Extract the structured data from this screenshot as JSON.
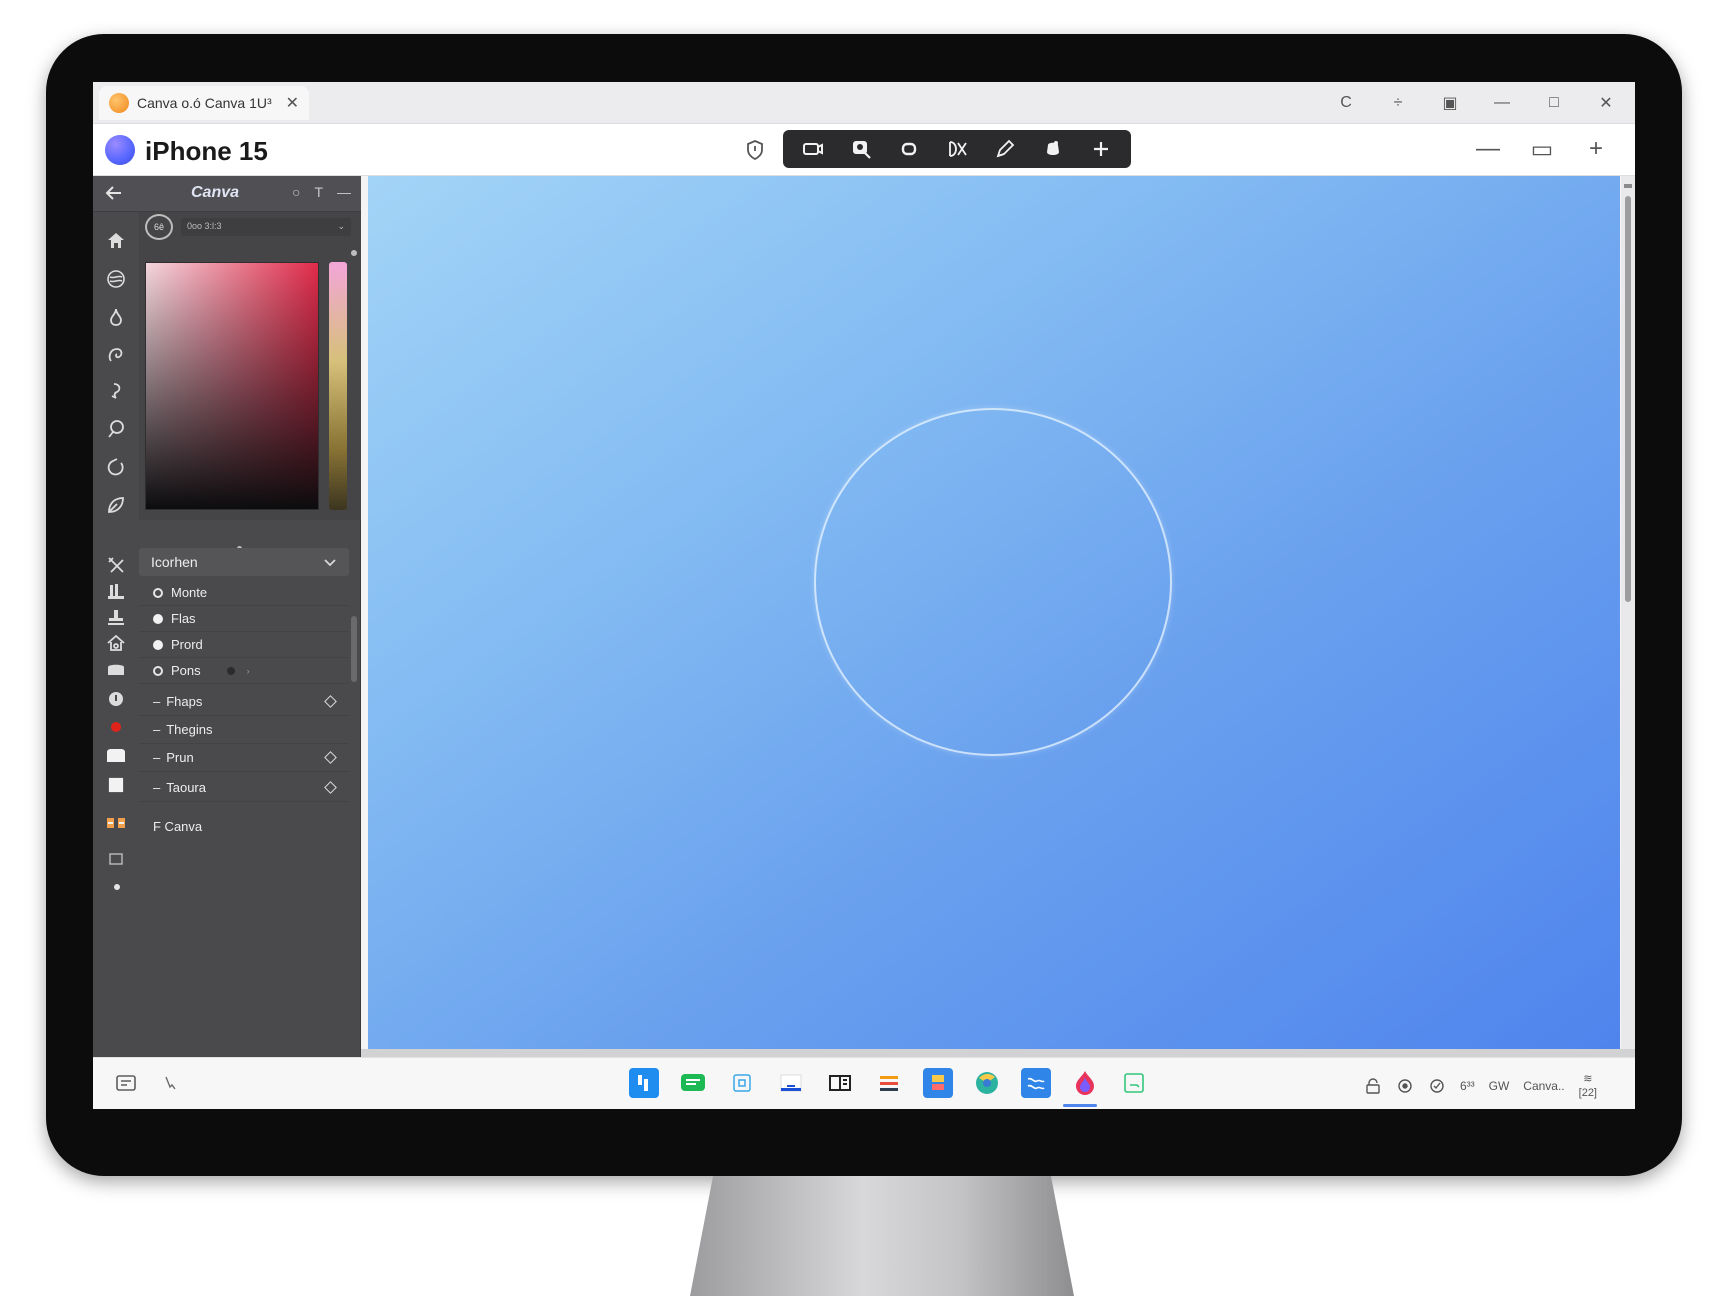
{
  "browser": {
    "tab_title": "Canva o.ó Canva 1U³",
    "tab_close": "✕",
    "controls": [
      "C",
      "÷",
      "▣",
      "—",
      "□",
      "✕"
    ]
  },
  "app": {
    "title": "iPhone 15",
    "zoom_out": "—",
    "zoom_fit": "▭",
    "zoom_in": "+"
  },
  "panel": {
    "title": "Canva",
    "color_value": "0oo 3:l:3",
    "eyedropper_label": "6ê",
    "dropdown": {
      "label": "Icorhen"
    },
    "options": [
      {
        "label": "Monte",
        "filled": false
      },
      {
        "label": "Flas",
        "filled": true
      },
      {
        "label": "Prord",
        "filled": true
      },
      {
        "label": "Pons",
        "filled": false
      }
    ],
    "groups": [
      {
        "label": "Fhaps",
        "dash": "–"
      },
      {
        "label": "Thegins",
        "dash": "–"
      },
      {
        "label": "Prun",
        "dash": "–"
      },
      {
        "label": "Taoura",
        "dash": "–"
      }
    ],
    "footer_label": "F Canva",
    "pons_arrow": "›"
  },
  "icons": {
    "rail": [
      "home-icon",
      "globe-icon",
      "drop-icon",
      "spiral-icon",
      "hook-icon",
      "lasso-icon",
      "rotate-icon",
      "leaf-icon"
    ],
    "toolbar": [
      "camera-icon",
      "image-search-icon",
      "shape-icon",
      "cut-icon",
      "pen-icon",
      "fill-icon",
      "plus-icon"
    ],
    "taskbar_apps": [
      "store-icon",
      "chat-icon",
      "frame-icon",
      "files-icon",
      "terminal-icon",
      "palette-icon",
      "docs-icon",
      "browser-icon",
      "mail-icon",
      "canva-icon",
      "notes-icon"
    ]
  },
  "taskbar": {
    "tray_label_1": "GW",
    "tray_label_2": "Canva..",
    "clock_top": "≋",
    "clock_bottom": "[22]",
    "tray_prefix": "6³³"
  },
  "colors": {
    "accent": "#4f84ed",
    "panel_bg": "#4a4a4d",
    "toolbar_bg": "#2b2b2e"
  }
}
